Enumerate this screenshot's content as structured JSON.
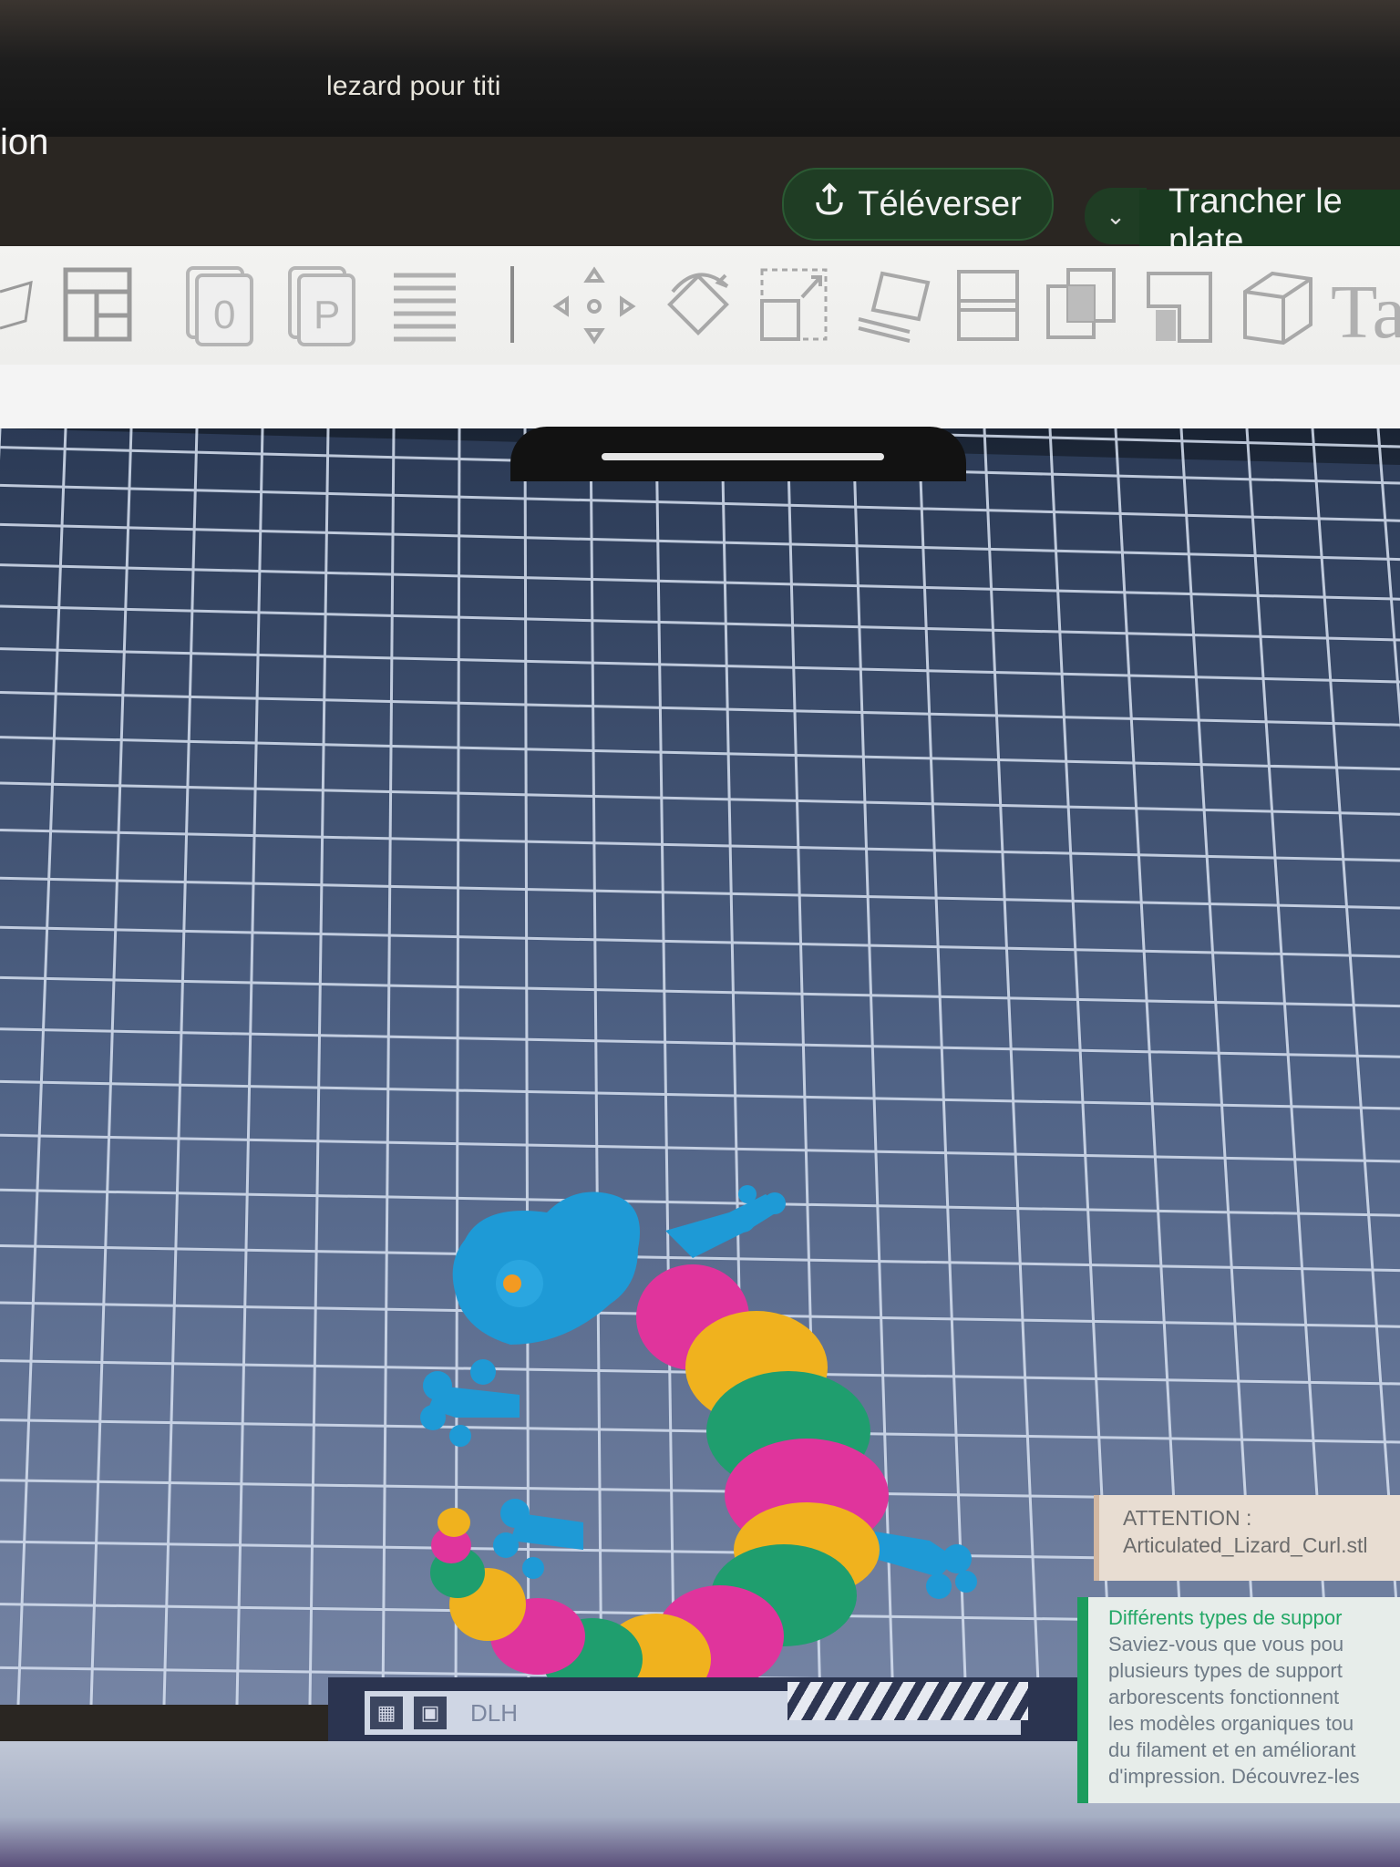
{
  "window": {
    "title": "lezard pour titi",
    "menu_fragment": "ion"
  },
  "actions": {
    "upload_label": "Téléverser",
    "slice_label": "Trancher le plate"
  },
  "toolbar": {
    "tools": [
      "add-object",
      "layout",
      "orient-plate",
      "plate-settings",
      "objects-list",
      "move",
      "rotate",
      "scale",
      "lay-on-face",
      "cut",
      "boolean",
      "supports",
      "seam",
      "measure",
      "text"
    ],
    "text_tool_label": "Ta"
  },
  "bottom_bar": {
    "label": "DLH"
  },
  "notifications": {
    "warning": {
      "title": "ATTENTION :",
      "body": "Articulated_Lizard_Curl.stl"
    },
    "tip": {
      "title": "Différents types de suppor",
      "lines": [
        "Saviez-vous que vous pou",
        "plusieurs types de support",
        "arborescents fonctionnent",
        "les modèles organiques tou",
        "du filament et en améliorant",
        "d'impression. Découvrez-les"
      ]
    }
  },
  "colors": {
    "accent": "#1c9c5d",
    "lizard_head": "#1e9ad6",
    "pink": "#e0349c",
    "yellow": "#f0b21e",
    "green": "#1f9e6e"
  }
}
